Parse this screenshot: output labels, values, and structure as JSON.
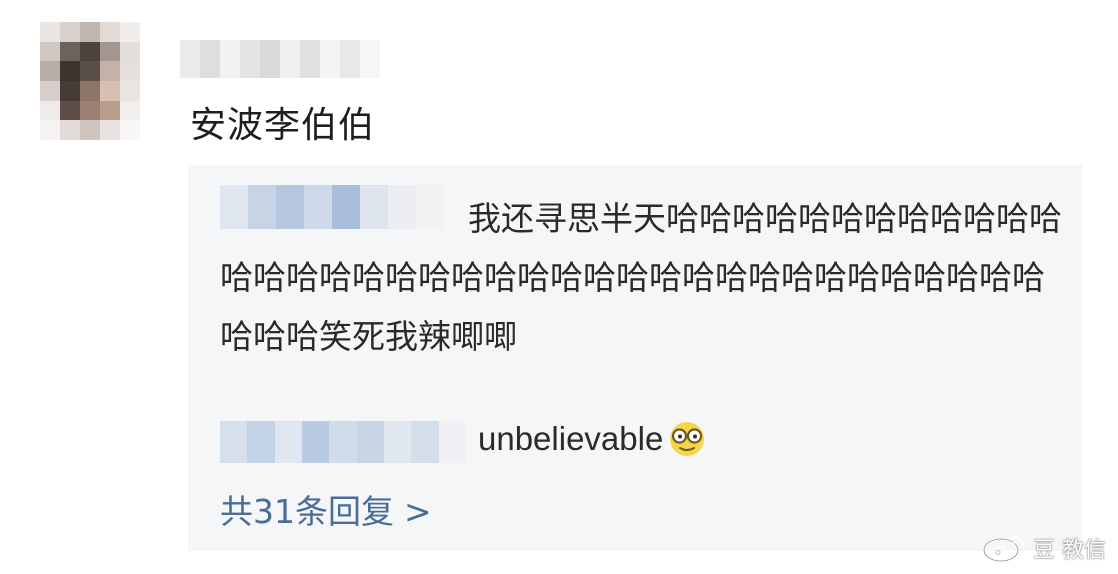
{
  "post": {
    "text": "安波李伯伯"
  },
  "reply": {
    "text": "我还寻思半天哈哈哈哈哈哈哈哈哈哈哈哈哈哈哈哈哈哈哈哈哈哈哈哈哈哈哈哈哈哈哈哈哈哈哈哈哈哈哈哈笑死我辣唧唧"
  },
  "reply2": {
    "text": "unbelievable"
  },
  "more_replies": {
    "label": "共31条回复",
    "chevron": ">"
  },
  "watermark": {
    "text": "豆 教信"
  },
  "colors": {
    "reply_background": "#f5f6f8",
    "link_blue": "#4a6c98",
    "text": "#2a2a2a"
  },
  "icons": [
    "glasses-emoji-icon",
    "weibo-logo-icon"
  ]
}
